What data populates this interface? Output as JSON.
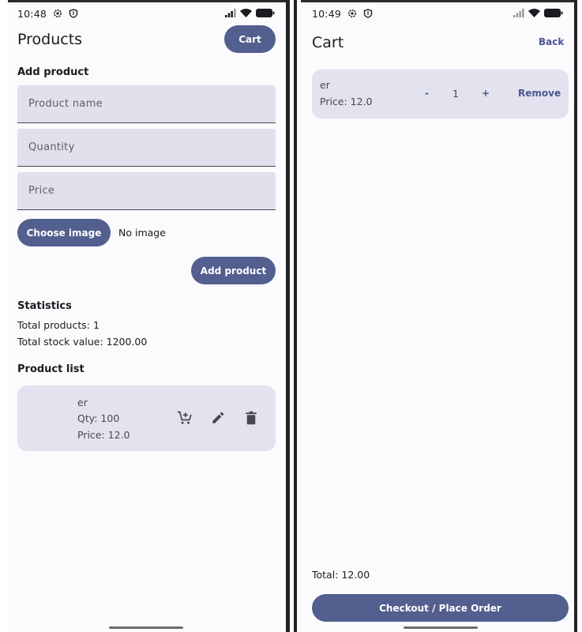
{
  "products_screen": {
    "status_time": "10:48",
    "title": "Products",
    "cart_button": "Cart",
    "add_product_heading": "Add product",
    "fields": {
      "name_placeholder": "Product name",
      "quantity_placeholder": "Quantity",
      "price_placeholder": "Price"
    },
    "choose_image_button": "Choose image",
    "image_status": "No image",
    "add_product_button": "Add product",
    "statistics_heading": "Statistics",
    "total_products": "Total products: 1",
    "total_stock_value": "Total stock value: 1200.00",
    "product_list_heading": "Product list",
    "products": [
      {
        "name": "er",
        "qty": "Qty: 100",
        "price": "Price: 12.0"
      }
    ],
    "product_actions": [
      "add-to-cart-icon",
      "edit-icon",
      "delete-icon"
    ]
  },
  "cart_screen": {
    "status_time": "10:49",
    "title": "Cart",
    "back_button": "Back",
    "items": [
      {
        "name": "er",
        "price": "Price: 12.0",
        "decrement": "-",
        "quantity": "1",
        "increment": "+",
        "remove": "Remove"
      }
    ],
    "total": "Total: 12.00",
    "checkout_button": "Checkout / Place Order"
  },
  "colors": {
    "accent": "#535f8e",
    "surface": "#fbfbfe",
    "card": "#e3e3ef",
    "field": "#e1e1ee"
  }
}
